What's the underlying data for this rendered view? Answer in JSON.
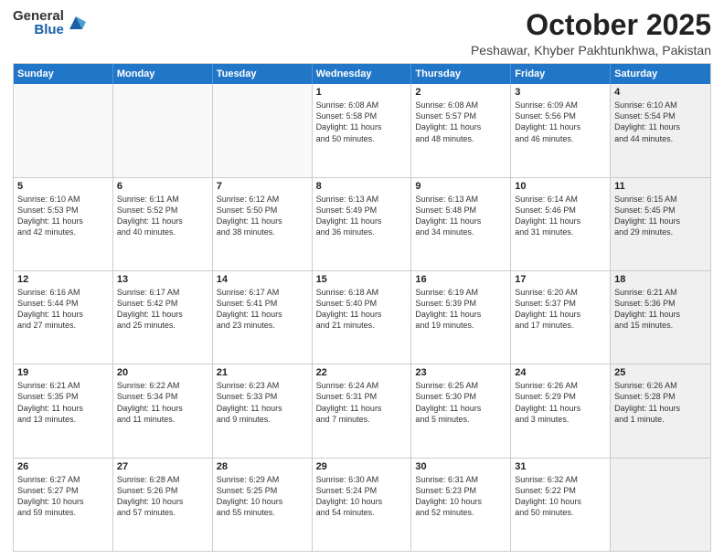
{
  "header": {
    "logo_general": "General",
    "logo_blue": "Blue",
    "month": "October 2025",
    "location": "Peshawar, Khyber Pakhtunkhwa, Pakistan"
  },
  "days_of_week": [
    "Sunday",
    "Monday",
    "Tuesday",
    "Wednesday",
    "Thursday",
    "Friday",
    "Saturday"
  ],
  "weeks": [
    [
      {
        "day": "",
        "text": "",
        "empty": true
      },
      {
        "day": "",
        "text": "",
        "empty": true
      },
      {
        "day": "",
        "text": "",
        "empty": true
      },
      {
        "day": "1",
        "text": "Sunrise: 6:08 AM\nSunset: 5:58 PM\nDaylight: 11 hours\nand 50 minutes."
      },
      {
        "day": "2",
        "text": "Sunrise: 6:08 AM\nSunset: 5:57 PM\nDaylight: 11 hours\nand 48 minutes."
      },
      {
        "day": "3",
        "text": "Sunrise: 6:09 AM\nSunset: 5:56 PM\nDaylight: 11 hours\nand 46 minutes."
      },
      {
        "day": "4",
        "text": "Sunrise: 6:10 AM\nSunset: 5:54 PM\nDaylight: 11 hours\nand 44 minutes.",
        "shaded": true
      }
    ],
    [
      {
        "day": "5",
        "text": "Sunrise: 6:10 AM\nSunset: 5:53 PM\nDaylight: 11 hours\nand 42 minutes."
      },
      {
        "day": "6",
        "text": "Sunrise: 6:11 AM\nSunset: 5:52 PM\nDaylight: 11 hours\nand 40 minutes."
      },
      {
        "day": "7",
        "text": "Sunrise: 6:12 AM\nSunset: 5:50 PM\nDaylight: 11 hours\nand 38 minutes."
      },
      {
        "day": "8",
        "text": "Sunrise: 6:13 AM\nSunset: 5:49 PM\nDaylight: 11 hours\nand 36 minutes."
      },
      {
        "day": "9",
        "text": "Sunrise: 6:13 AM\nSunset: 5:48 PM\nDaylight: 11 hours\nand 34 minutes."
      },
      {
        "day": "10",
        "text": "Sunrise: 6:14 AM\nSunset: 5:46 PM\nDaylight: 11 hours\nand 31 minutes."
      },
      {
        "day": "11",
        "text": "Sunrise: 6:15 AM\nSunset: 5:45 PM\nDaylight: 11 hours\nand 29 minutes.",
        "shaded": true
      }
    ],
    [
      {
        "day": "12",
        "text": "Sunrise: 6:16 AM\nSunset: 5:44 PM\nDaylight: 11 hours\nand 27 minutes."
      },
      {
        "day": "13",
        "text": "Sunrise: 6:17 AM\nSunset: 5:42 PM\nDaylight: 11 hours\nand 25 minutes."
      },
      {
        "day": "14",
        "text": "Sunrise: 6:17 AM\nSunset: 5:41 PM\nDaylight: 11 hours\nand 23 minutes."
      },
      {
        "day": "15",
        "text": "Sunrise: 6:18 AM\nSunset: 5:40 PM\nDaylight: 11 hours\nand 21 minutes."
      },
      {
        "day": "16",
        "text": "Sunrise: 6:19 AM\nSunset: 5:39 PM\nDaylight: 11 hours\nand 19 minutes."
      },
      {
        "day": "17",
        "text": "Sunrise: 6:20 AM\nSunset: 5:37 PM\nDaylight: 11 hours\nand 17 minutes."
      },
      {
        "day": "18",
        "text": "Sunrise: 6:21 AM\nSunset: 5:36 PM\nDaylight: 11 hours\nand 15 minutes.",
        "shaded": true
      }
    ],
    [
      {
        "day": "19",
        "text": "Sunrise: 6:21 AM\nSunset: 5:35 PM\nDaylight: 11 hours\nand 13 minutes."
      },
      {
        "day": "20",
        "text": "Sunrise: 6:22 AM\nSunset: 5:34 PM\nDaylight: 11 hours\nand 11 minutes."
      },
      {
        "day": "21",
        "text": "Sunrise: 6:23 AM\nSunset: 5:33 PM\nDaylight: 11 hours\nand 9 minutes."
      },
      {
        "day": "22",
        "text": "Sunrise: 6:24 AM\nSunset: 5:31 PM\nDaylight: 11 hours\nand 7 minutes."
      },
      {
        "day": "23",
        "text": "Sunrise: 6:25 AM\nSunset: 5:30 PM\nDaylight: 11 hours\nand 5 minutes."
      },
      {
        "day": "24",
        "text": "Sunrise: 6:26 AM\nSunset: 5:29 PM\nDaylight: 11 hours\nand 3 minutes."
      },
      {
        "day": "25",
        "text": "Sunrise: 6:26 AM\nSunset: 5:28 PM\nDaylight: 11 hours\nand 1 minute.",
        "shaded": true
      }
    ],
    [
      {
        "day": "26",
        "text": "Sunrise: 6:27 AM\nSunset: 5:27 PM\nDaylight: 10 hours\nand 59 minutes."
      },
      {
        "day": "27",
        "text": "Sunrise: 6:28 AM\nSunset: 5:26 PM\nDaylight: 10 hours\nand 57 minutes."
      },
      {
        "day": "28",
        "text": "Sunrise: 6:29 AM\nSunset: 5:25 PM\nDaylight: 10 hours\nand 55 minutes."
      },
      {
        "day": "29",
        "text": "Sunrise: 6:30 AM\nSunset: 5:24 PM\nDaylight: 10 hours\nand 54 minutes."
      },
      {
        "day": "30",
        "text": "Sunrise: 6:31 AM\nSunset: 5:23 PM\nDaylight: 10 hours\nand 52 minutes."
      },
      {
        "day": "31",
        "text": "Sunrise: 6:32 AM\nSunset: 5:22 PM\nDaylight: 10 hours\nand 50 minutes."
      },
      {
        "day": "",
        "text": "",
        "empty": true,
        "shaded": true
      }
    ]
  ]
}
